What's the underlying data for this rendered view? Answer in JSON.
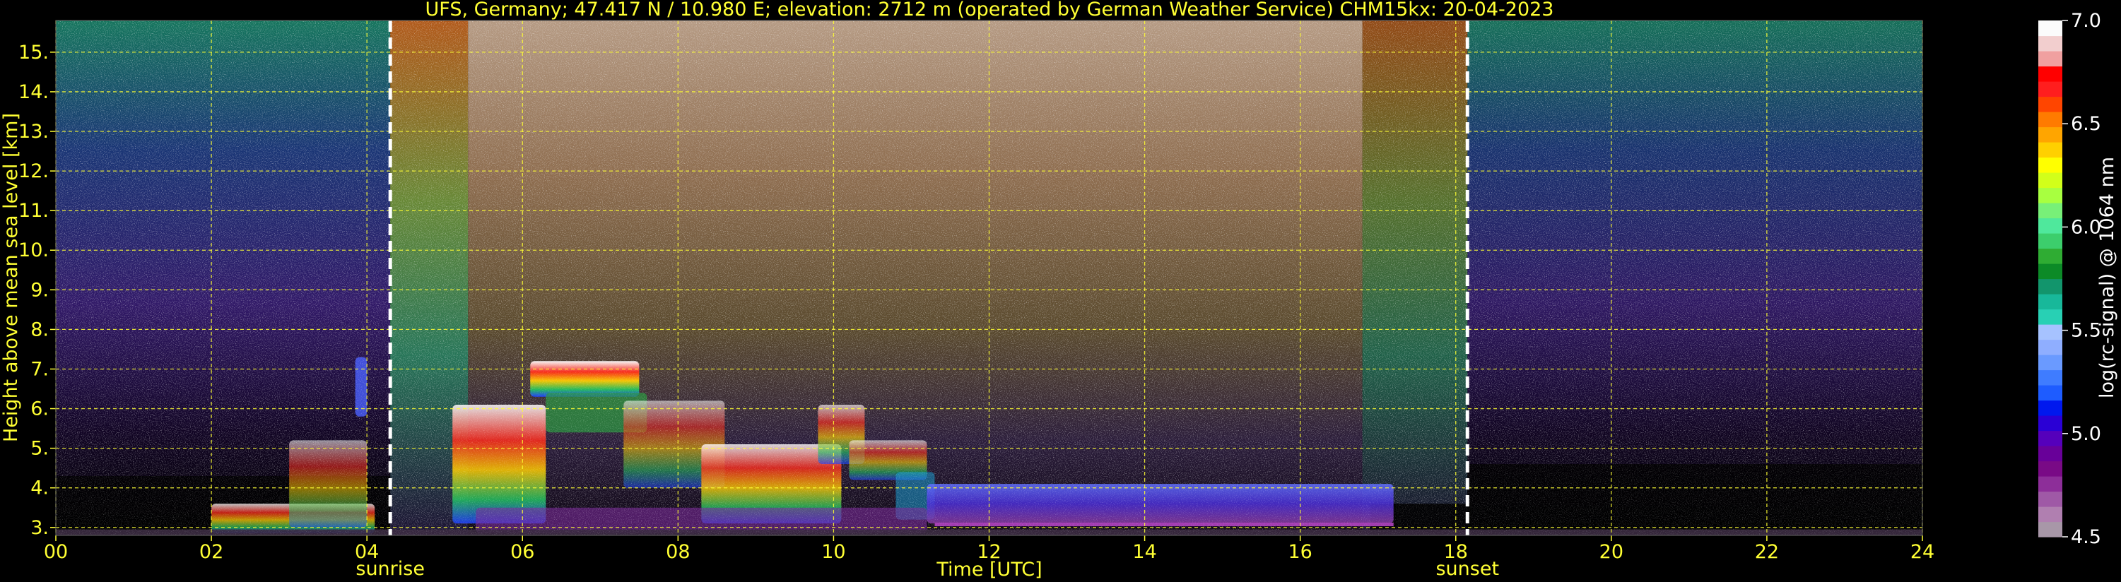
{
  "chart_data": {
    "type": "heatmap",
    "title": "UFS, Germany; 47.417 N / 10.980 E; elevation: 2712 m  (operated by German Weather Service)    CHM15kx: 20-04-2023",
    "xlabel": "Time [UTC]",
    "ylabel": "Height above mean sea level [km]",
    "xlim": [
      0,
      24
    ],
    "ylim": [
      2.8,
      15.8
    ],
    "x_ticks": [
      0,
      2,
      4,
      6,
      8,
      10,
      12,
      14,
      16,
      18,
      20,
      22,
      24
    ],
    "x_tick_labels": [
      "00",
      "02",
      "04",
      "06",
      "08",
      "10",
      "12",
      "14",
      "16",
      "18",
      "20",
      "22",
      "24"
    ],
    "y_ticks": [
      3,
      4,
      5,
      6,
      7,
      8,
      9,
      10,
      11,
      12,
      13,
      14,
      15
    ],
    "y_tick_labels": [
      "3.",
      "4.",
      "5.",
      "6.",
      "7.",
      "8.",
      "9.",
      "10.",
      "11.",
      "12.",
      "13.",
      "14.",
      "15."
    ],
    "grid": true,
    "events": [
      {
        "label": "sunrise",
        "time": 4.3
      },
      {
        "label": "sunset",
        "time": 18.15
      }
    ],
    "colorbar": {
      "label": "log(rc-signal) @ 1064 nm",
      "range": [
        4.5,
        7.0
      ],
      "ticks": [
        4.5,
        5.0,
        5.5,
        6.0,
        6.5,
        7.0
      ],
      "tick_labels": [
        "4.5",
        "5.0",
        "5.5",
        "6.0",
        "6.5",
        "7.0"
      ],
      "colors": [
        "#a897a8",
        "#b07fb0",
        "#9f59a6",
        "#8d2e99",
        "#790a86",
        "#680099",
        "#5500bb",
        "#2a00d5",
        "#0018ee",
        "#1e5cff",
        "#3f7cff",
        "#6a9aff",
        "#8faeff",
        "#a6c2ff",
        "#28d0b4",
        "#18b89a",
        "#12956c",
        "#0c8a27",
        "#2fac33",
        "#3cce6c",
        "#4fe89c",
        "#78f078",
        "#a8ff40",
        "#d2ff1a",
        "#ffff00",
        "#ffd000",
        "#ffa500",
        "#ff7b00",
        "#ff4500",
        "#ff1e1e",
        "#ff0000",
        "#f0a0a0",
        "#f2cece",
        "#fbfbfb"
      ]
    },
    "features": [
      {
        "label": "cloud layer",
        "x": [
          6.1,
          7.5
        ],
        "y": [
          6.3,
          7.2
        ]
      },
      {
        "label": "cloud layer",
        "x": [
          7.3,
          10.3
        ],
        "y": [
          3.3,
          6.2
        ]
      },
      {
        "label": "boundary layer",
        "x": [
          11.2,
          17.2
        ],
        "y": [
          3.1,
          4.1
        ]
      }
    ]
  }
}
